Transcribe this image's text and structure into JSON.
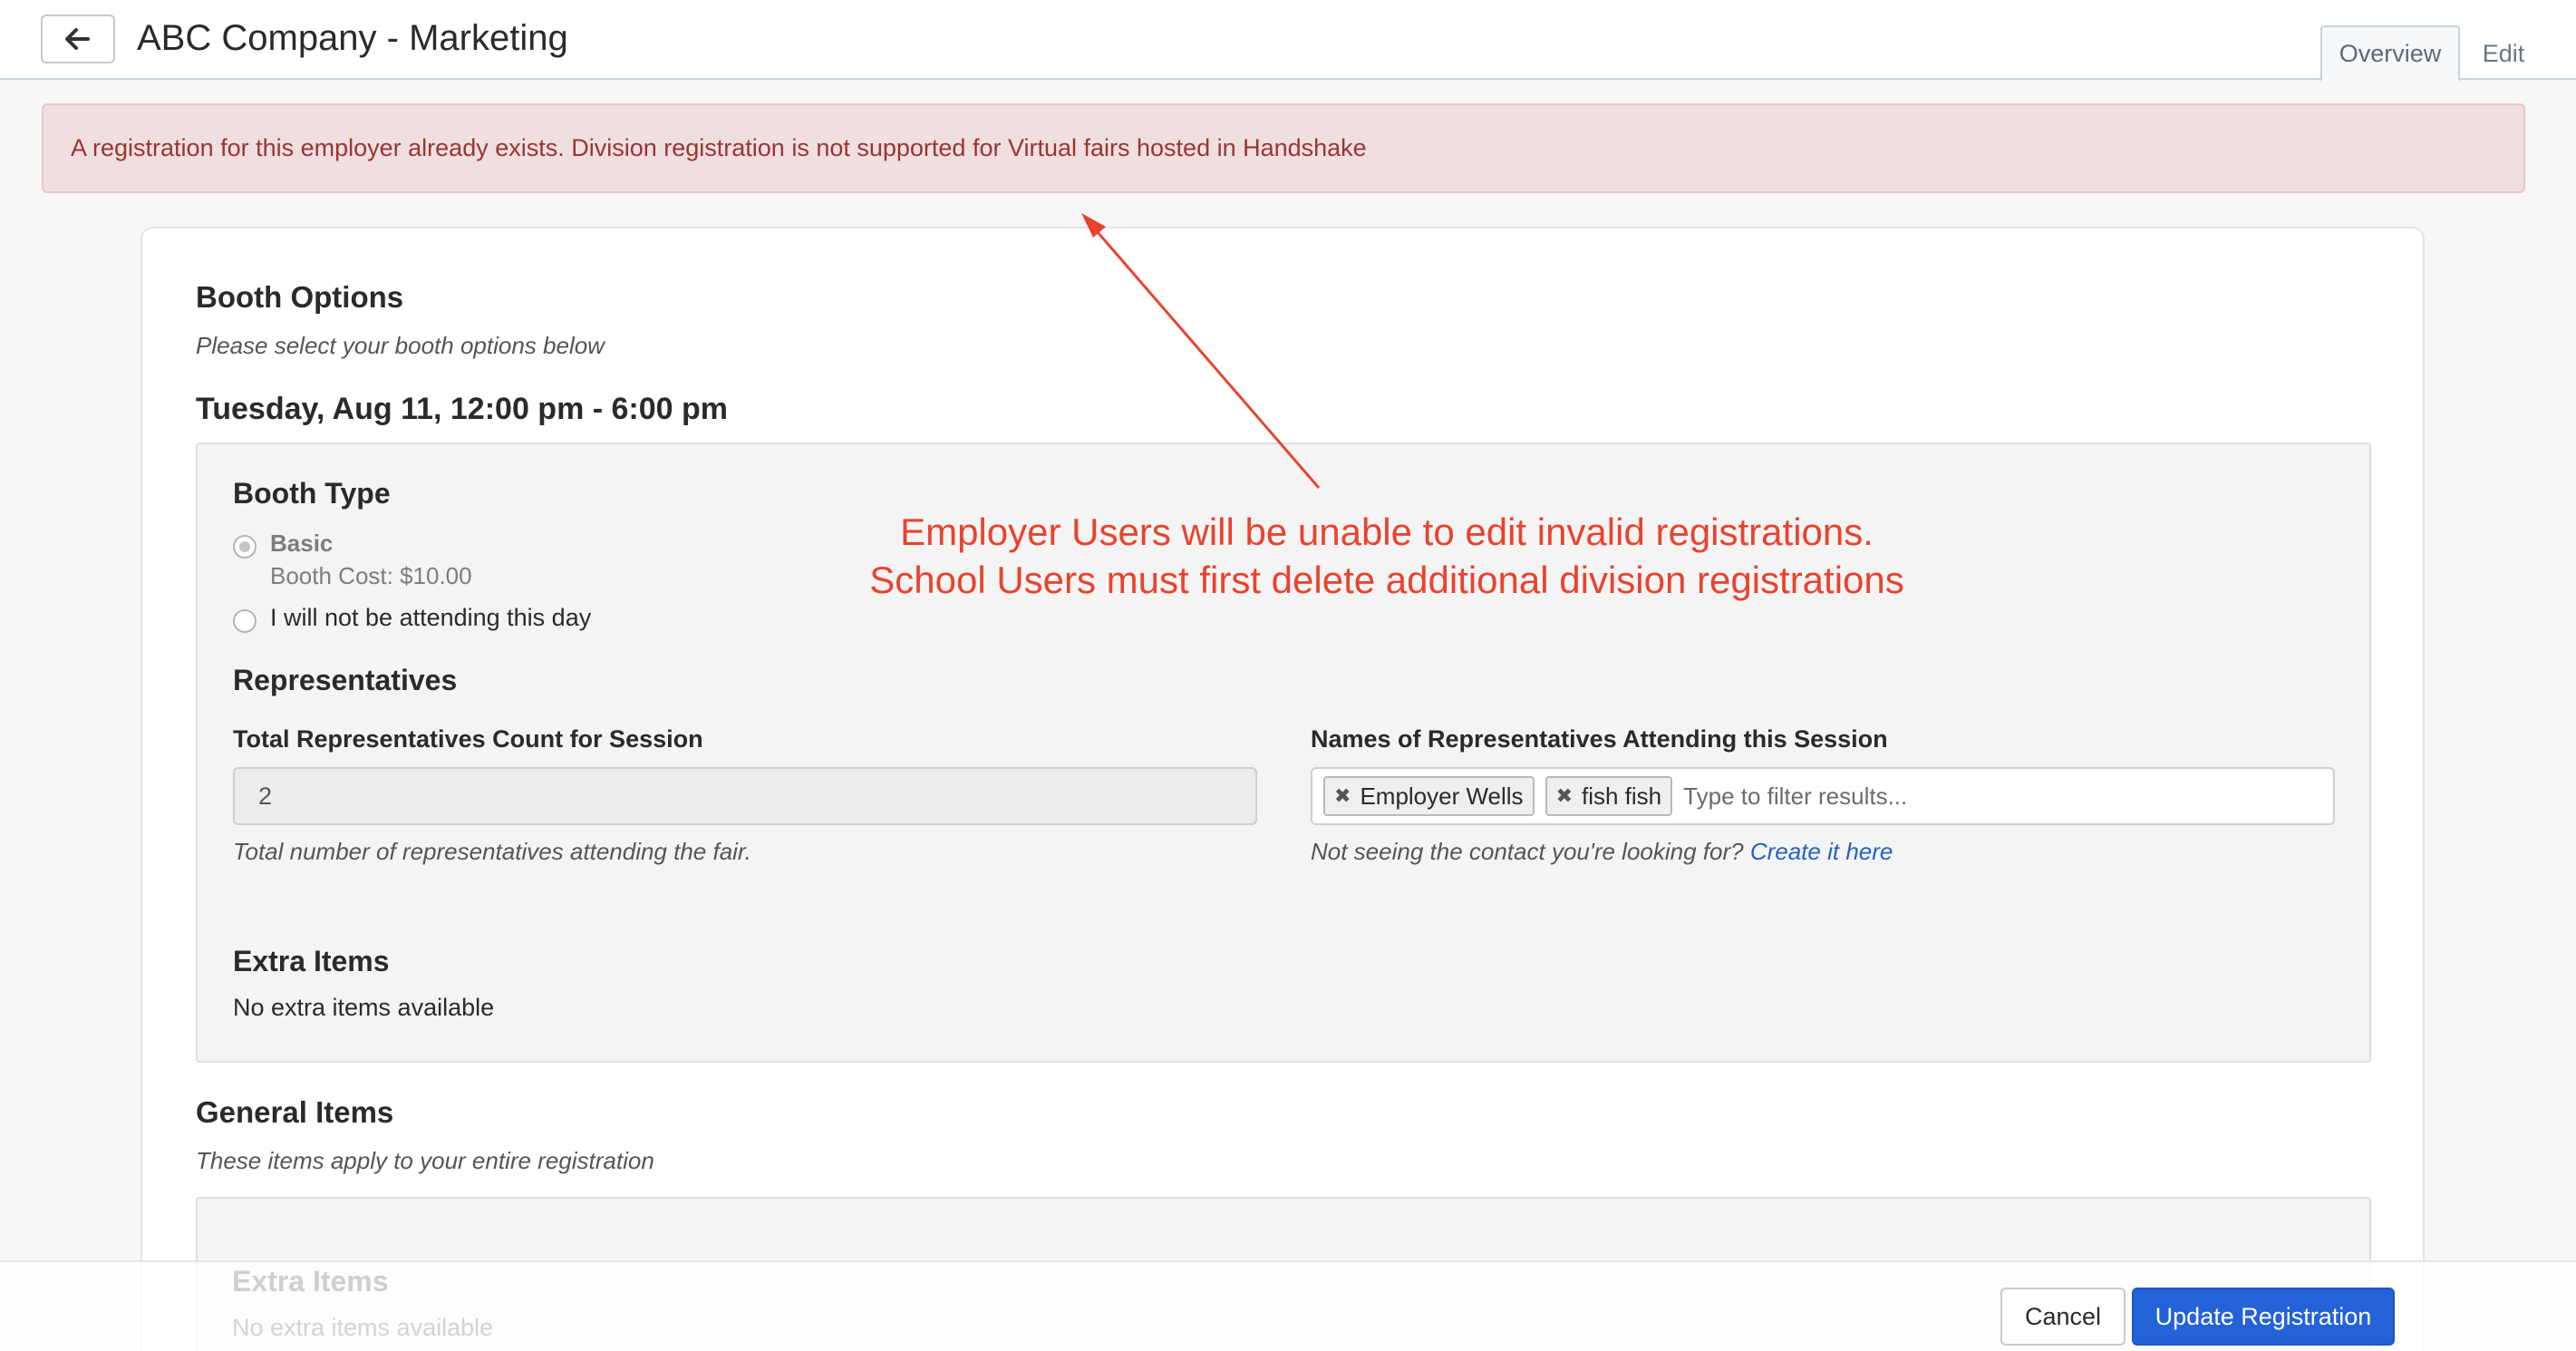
{
  "header": {
    "back_label": "Back",
    "title": "ABC Company - Marketing",
    "tabs": [
      {
        "label": "Overview",
        "active": true
      },
      {
        "label": "Edit",
        "active": false
      }
    ]
  },
  "alert": {
    "text": "A registration for this employer already exists. Division registration is not supported for Virtual fairs hosted in Handshake"
  },
  "booth_options": {
    "title": "Booth Options",
    "subtitle": "Please select your booth options below",
    "session": {
      "date_label": "Tuesday, Aug 11, 12:00 pm - 6:00 pm",
      "booth_type": {
        "title": "Booth Type",
        "options": [
          {
            "label": "Basic",
            "detail": "Booth Cost: $10.00",
            "selected": true
          },
          {
            "label": "I will not be attending this day",
            "selected": false
          }
        ]
      },
      "representatives": {
        "title": "Representatives",
        "count_label": "Total Representatives Count for Session",
        "count_value": "2",
        "count_help": "Total number of representatives attending the fair.",
        "names_label": "Names of Representatives Attending this Session",
        "names": [
          "Employer Wells",
          "fish fish"
        ],
        "names_placeholder": "Type to filter results...",
        "names_help": "Not seeing the contact you're looking for?",
        "names_help_link": "Create it here"
      },
      "extra_items": {
        "title": "Extra Items",
        "empty": "No extra items available"
      }
    }
  },
  "general_items": {
    "title": "General Items",
    "subtitle": "These items apply to your entire registration",
    "extra_items": {
      "title": "Extra Items",
      "empty": "No extra items available"
    }
  },
  "footer": {
    "cancel_label": "Cancel",
    "update_label": "Update Registration"
  },
  "annotation": {
    "line1": "Employer Users will be unable to edit invalid registrations.",
    "line2": "School Users must first delete additional division registrations",
    "color": "#e8432e"
  },
  "colors": {
    "primary_button": "#2462d8",
    "alert_bg": "#f0dfe0",
    "alert_text": "#9b3431",
    "link": "#2462c6"
  }
}
